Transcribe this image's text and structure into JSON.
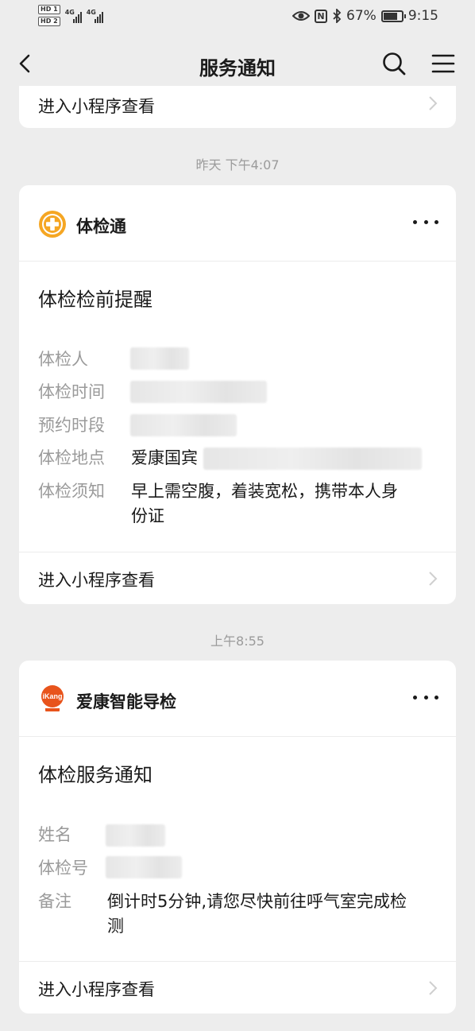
{
  "status_bar": {
    "hd1": "HD 1",
    "hd2": "HD 2",
    "net1": "4G",
    "net2": "4G",
    "nfc": "N",
    "battery_percent": "67%",
    "time": "9:15"
  },
  "nav": {
    "title": "服务通知"
  },
  "top_card": {
    "action_label": "进入小程序查看"
  },
  "timestamps": {
    "t1": "昨天 下午4:07",
    "t2": "上午8:55"
  },
  "card1": {
    "app_name": "体检通",
    "message_title": "体检检前提醒",
    "fields": [
      {
        "label": "体检人",
        "value": ""
      },
      {
        "label": "体检时间",
        "value": ""
      },
      {
        "label": "预约时段",
        "value": ""
      },
      {
        "label": "体检地点",
        "value": "爱康国宾"
      },
      {
        "label": "体检须知",
        "value_line1": "早上需空腹，着装宽松，携带本人身",
        "value_line2": "份证"
      }
    ],
    "action_label": "进入小程序查看"
  },
  "card2": {
    "app_name": "爱康智能导检",
    "app_icon_text": "iKang",
    "message_title": "体检服务通知",
    "fields": [
      {
        "label": "姓名",
        "value": ""
      },
      {
        "label": "体检号",
        "value": ""
      },
      {
        "label": "备注",
        "value_line1": "倒计时5分钟,请您尽快前往呼气室完成检",
        "value_line2": "测"
      }
    ],
    "action_label": "进入小程序查看"
  },
  "colors": {
    "background": "#ededed",
    "card": "#ffffff",
    "orange": "#f5a623",
    "ikang_red": "#e8541c",
    "label_gray": "#9a9a9a"
  }
}
